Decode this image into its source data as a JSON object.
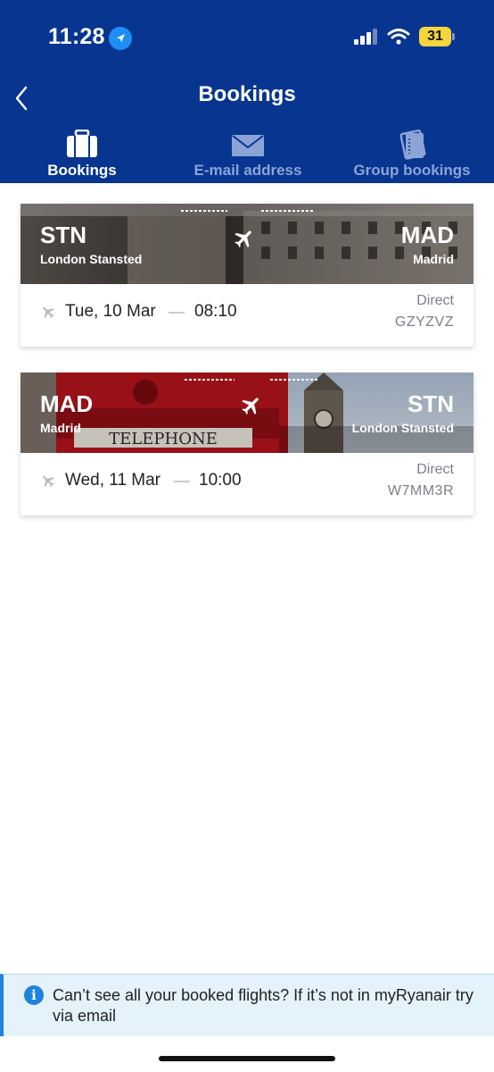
{
  "status_bar": {
    "time": "11:28",
    "battery": "31"
  },
  "header": {
    "title": "Bookings",
    "tabs": [
      {
        "label": "Bookings",
        "icon": "suitcase-icon",
        "active": true
      },
      {
        "label": "E-mail address",
        "icon": "envelope-icon",
        "active": false
      },
      {
        "label": "Group bookings",
        "icon": "tickets-icon",
        "active": false
      }
    ]
  },
  "bookings": [
    {
      "origin_code": "STN",
      "origin_city": "London Stansted",
      "destination_code": "MAD",
      "destination_city": "Madrid",
      "date": "Tue, 10 Mar",
      "time": "08:10",
      "type": "Direct",
      "reference": "GZYZVZ"
    },
    {
      "origin_code": "MAD",
      "origin_city": "Madrid",
      "destination_code": "STN",
      "destination_city": "London Stansted",
      "date": "Wed, 11 Mar",
      "time": "10:00",
      "type": "Direct",
      "reference": "W7MM3R"
    }
  ],
  "info_banner": {
    "text": "Can’t see all your booked flights? If it’s not in myRyanair try via email"
  },
  "colors": {
    "header_bg": "#073590",
    "tab_inactive": "#8ca3d6",
    "info_bg": "#e4f2fc",
    "info_accent": "#1e83dd"
  }
}
